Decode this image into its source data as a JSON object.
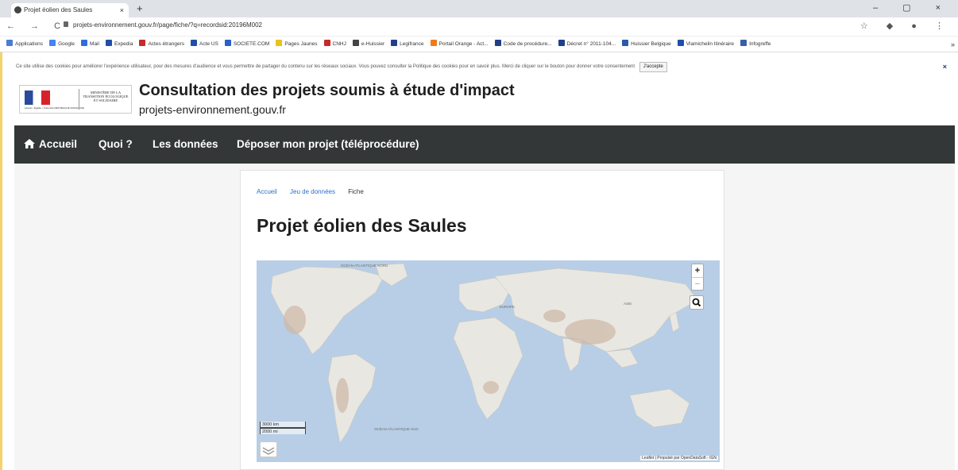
{
  "browser": {
    "tab_title": "Projet éolien des Saules",
    "url": "projets-environnement.gouv.fr/page/fiche/?q=recordsid:20196M002",
    "bookmarks": [
      {
        "label": "Applications",
        "color": "#4a7bd6"
      },
      {
        "label": "Google",
        "color": "#4285f4"
      },
      {
        "label": "Mail",
        "color": "#2d6fd8"
      },
      {
        "label": "Expedia",
        "color": "#1f4fa8"
      },
      {
        "label": "Actes étrangers",
        "color": "#c72a2a"
      },
      {
        "label": "Acte US",
        "color": "#1f4fa8"
      },
      {
        "label": "SOCIETE.COM",
        "color": "#2563c9"
      },
      {
        "label": "Pages Jaunes",
        "color": "#e9c21b"
      },
      {
        "label": "CNHJ",
        "color": "#c72a2a"
      },
      {
        "label": "e-Huissier",
        "color": "#444444"
      },
      {
        "label": "Legifrance",
        "color": "#1f3f8a"
      },
      {
        "label": "Portail Orange - Act...",
        "color": "#f07a1a"
      },
      {
        "label": "Code de procédure...",
        "color": "#1f3f8a"
      },
      {
        "label": "Décret n° 2011-104...",
        "color": "#1f3f8a"
      },
      {
        "label": "Huissier Belgique",
        "color": "#2a5aa8"
      },
      {
        "label": "Vlamichelin Itinéraire",
        "color": "#1f4fa8"
      },
      {
        "label": "Infogreffe",
        "color": "#3a5ea8"
      }
    ],
    "bookmarks_more": "»"
  },
  "cookie_bar": {
    "text": "Ce site utilise des cookies pour améliorer l'expérience utilisateur, pour des mesures d'audience et vous permettre de partager du contenu sur les réseaux sociaux. Vous pouvez consulter la Politique des cookies pour en savoir plus. Merci de cliquer sur le bouton pour donner votre consentement",
    "accept_label": "J'accepte",
    "close_label": "×"
  },
  "header": {
    "logo_caption": "Liberté • Égalité • Fraternité RÉPUBLIQUE FRANÇAISE",
    "ministry": "MINISTÈRE DE LA TRANSITION ÉCOLOGIQUE ET SOLIDAIRE",
    "title": "Consultation des projets soumis à étude d'impact",
    "url": "projets-environnement.gouv.fr"
  },
  "nav": {
    "home": "Accueil",
    "what": "Quoi ?",
    "data": "Les données",
    "submit": "Déposer mon projet (téléprocédure)"
  },
  "breadcrumb": {
    "home": "Accueil",
    "dataset": "Jeu de données",
    "current": "Fiche"
  },
  "page_title": "Projet éolien des Saules",
  "map": {
    "zoom_in": "+",
    "zoom_out": "−",
    "scale_km": "3000 km",
    "scale_mi": "2000 mi",
    "attribution": "Leaflet | Propulsé par OpenDataSoft - IGN",
    "labels": {
      "north_atlantic": "OCÉAN ATLANTIQUE NORD",
      "europe": "EUROPE",
      "asia": "ASIE",
      "south_atlantic": "OCÉAN ATLANTIQUE SUD"
    }
  }
}
